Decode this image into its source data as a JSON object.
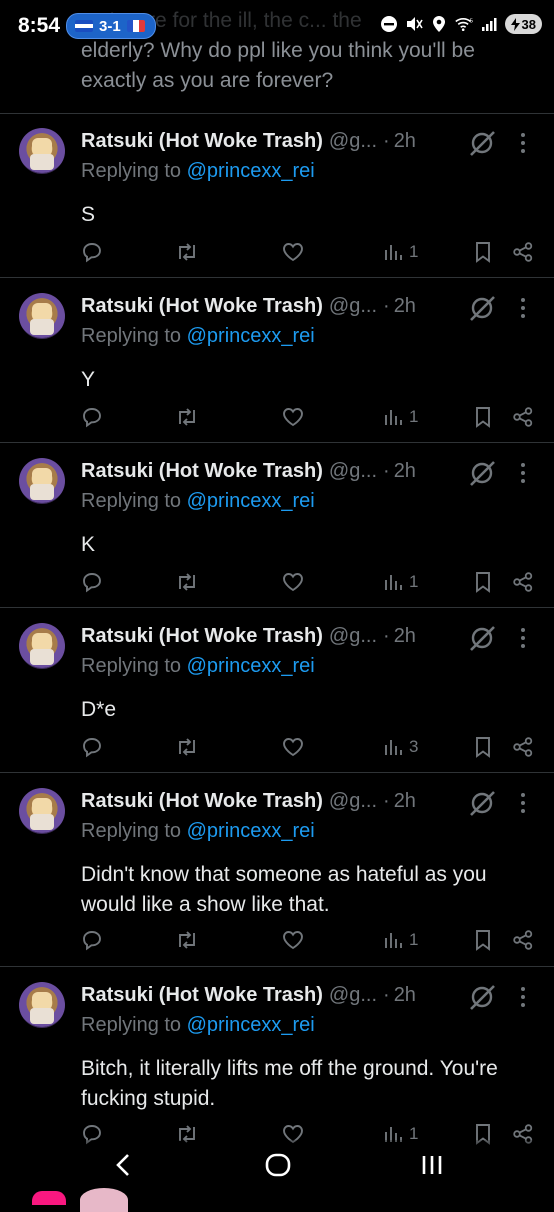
{
  "status_bar": {
    "time": "8:54",
    "score": "3-1",
    "battery": "38",
    "network": "5"
  },
  "top_tweet": {
    "line1_faded": "...n't care for the ill, the c... the",
    "line2": "elderly? Why do ppl like you think you'll be",
    "line3": "exactly as you are forever?"
  },
  "replies": [
    {
      "name": "Ratsuki (Hot Woke Trash)",
      "handle": "@g...",
      "dot": "·",
      "time": "2h",
      "replying_prefix": "Replying to",
      "replying_to": "@princexx_rei",
      "text": "S",
      "views": "1"
    },
    {
      "name": "Ratsuki (Hot Woke Trash)",
      "handle": "@g...",
      "dot": "·",
      "time": "2h",
      "replying_prefix": "Replying to",
      "replying_to": "@princexx_rei",
      "text": "Y",
      "views": "1"
    },
    {
      "name": "Ratsuki (Hot Woke Trash)",
      "handle": "@g...",
      "dot": "·",
      "time": "2h",
      "replying_prefix": "Replying to",
      "replying_to": "@princexx_rei",
      "text": "K",
      "views": "1"
    },
    {
      "name": "Ratsuki (Hot Woke Trash)",
      "handle": "@g...",
      "dot": "·",
      "time": "2h",
      "replying_prefix": "Replying to",
      "replying_to": "@princexx_rei",
      "text": "D*e",
      "views": "3"
    },
    {
      "name": "Ratsuki (Hot Woke Trash)",
      "handle": "@g...",
      "dot": "·",
      "time": "2h",
      "replying_prefix": "Replying to",
      "replying_to": "@princexx_rei",
      "text": "Didn't know that someone as hateful as you would like a show like that.",
      "views": "1"
    },
    {
      "name": "Ratsuki (Hot Woke Trash)",
      "handle": "@g...",
      "dot": "·",
      "time": "2h",
      "replying_prefix": "Replying to",
      "replying_to": "@princexx_rei",
      "text": "Bitch, it literally lifts me off the ground. You're fucking stupid.",
      "views": "1"
    }
  ],
  "icons": {
    "reply": "reply-icon",
    "retweet": "retweet-icon",
    "like": "heart-icon",
    "views": "views-icon",
    "bookmark": "bookmark-icon",
    "share": "share-icon",
    "grok": "grok-icon",
    "more": "more-vertical-icon"
  },
  "colors": {
    "link": "#1d9bf0",
    "muted": "#71767b",
    "text": "#e7e9ea",
    "divider": "#2f3336"
  }
}
